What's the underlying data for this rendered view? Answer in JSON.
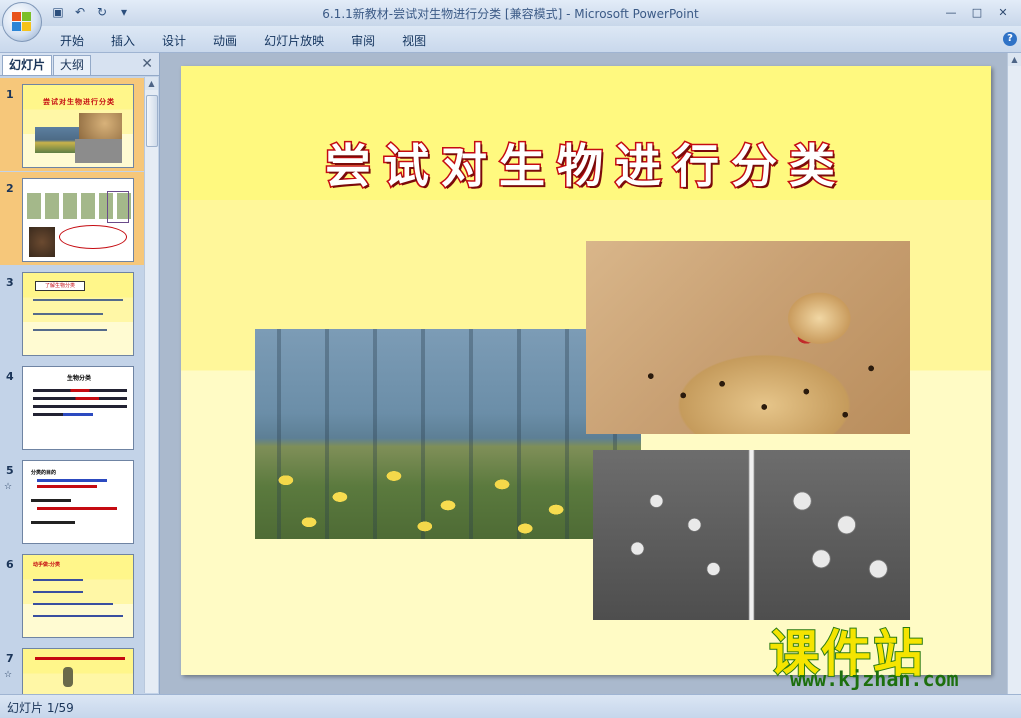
{
  "window": {
    "title": "6.1.1新教材-尝试对生物进行分类 [兼容模式] - Microsoft PowerPoint",
    "controls": [
      "minimize",
      "maximize",
      "close"
    ]
  },
  "quick_access": [
    "save-icon",
    "undo-icon",
    "redo-icon",
    "customize-icon"
  ],
  "ribbon": {
    "tabs": [
      "开始",
      "插入",
      "设计",
      "动画",
      "幻灯片放映",
      "审阅",
      "视图"
    ]
  },
  "pane": {
    "tab_slides": "幻灯片",
    "tab_outline": "大纲",
    "slides": [
      {
        "num": "1",
        "title": "尝试对生物进行分类"
      },
      {
        "num": "2",
        "title": ""
      },
      {
        "num": "3",
        "title": "了解生物分类"
      },
      {
        "num": "4",
        "title": "生物分类"
      },
      {
        "num": "5",
        "title": "分类的目的"
      },
      {
        "num": "6",
        "title": "动手做:分类"
      },
      {
        "num": "7",
        "title": ""
      }
    ]
  },
  "slide": {
    "title": "尝试对生物进行分类",
    "images": [
      "forest-daffodils-photo",
      "cheetah-photo",
      "microbe-micrograph-photo"
    ]
  },
  "status": {
    "text": "幻灯片 1/59"
  },
  "watermark": {
    "main": "课件站",
    "url": "www.kjzhan.com"
  }
}
